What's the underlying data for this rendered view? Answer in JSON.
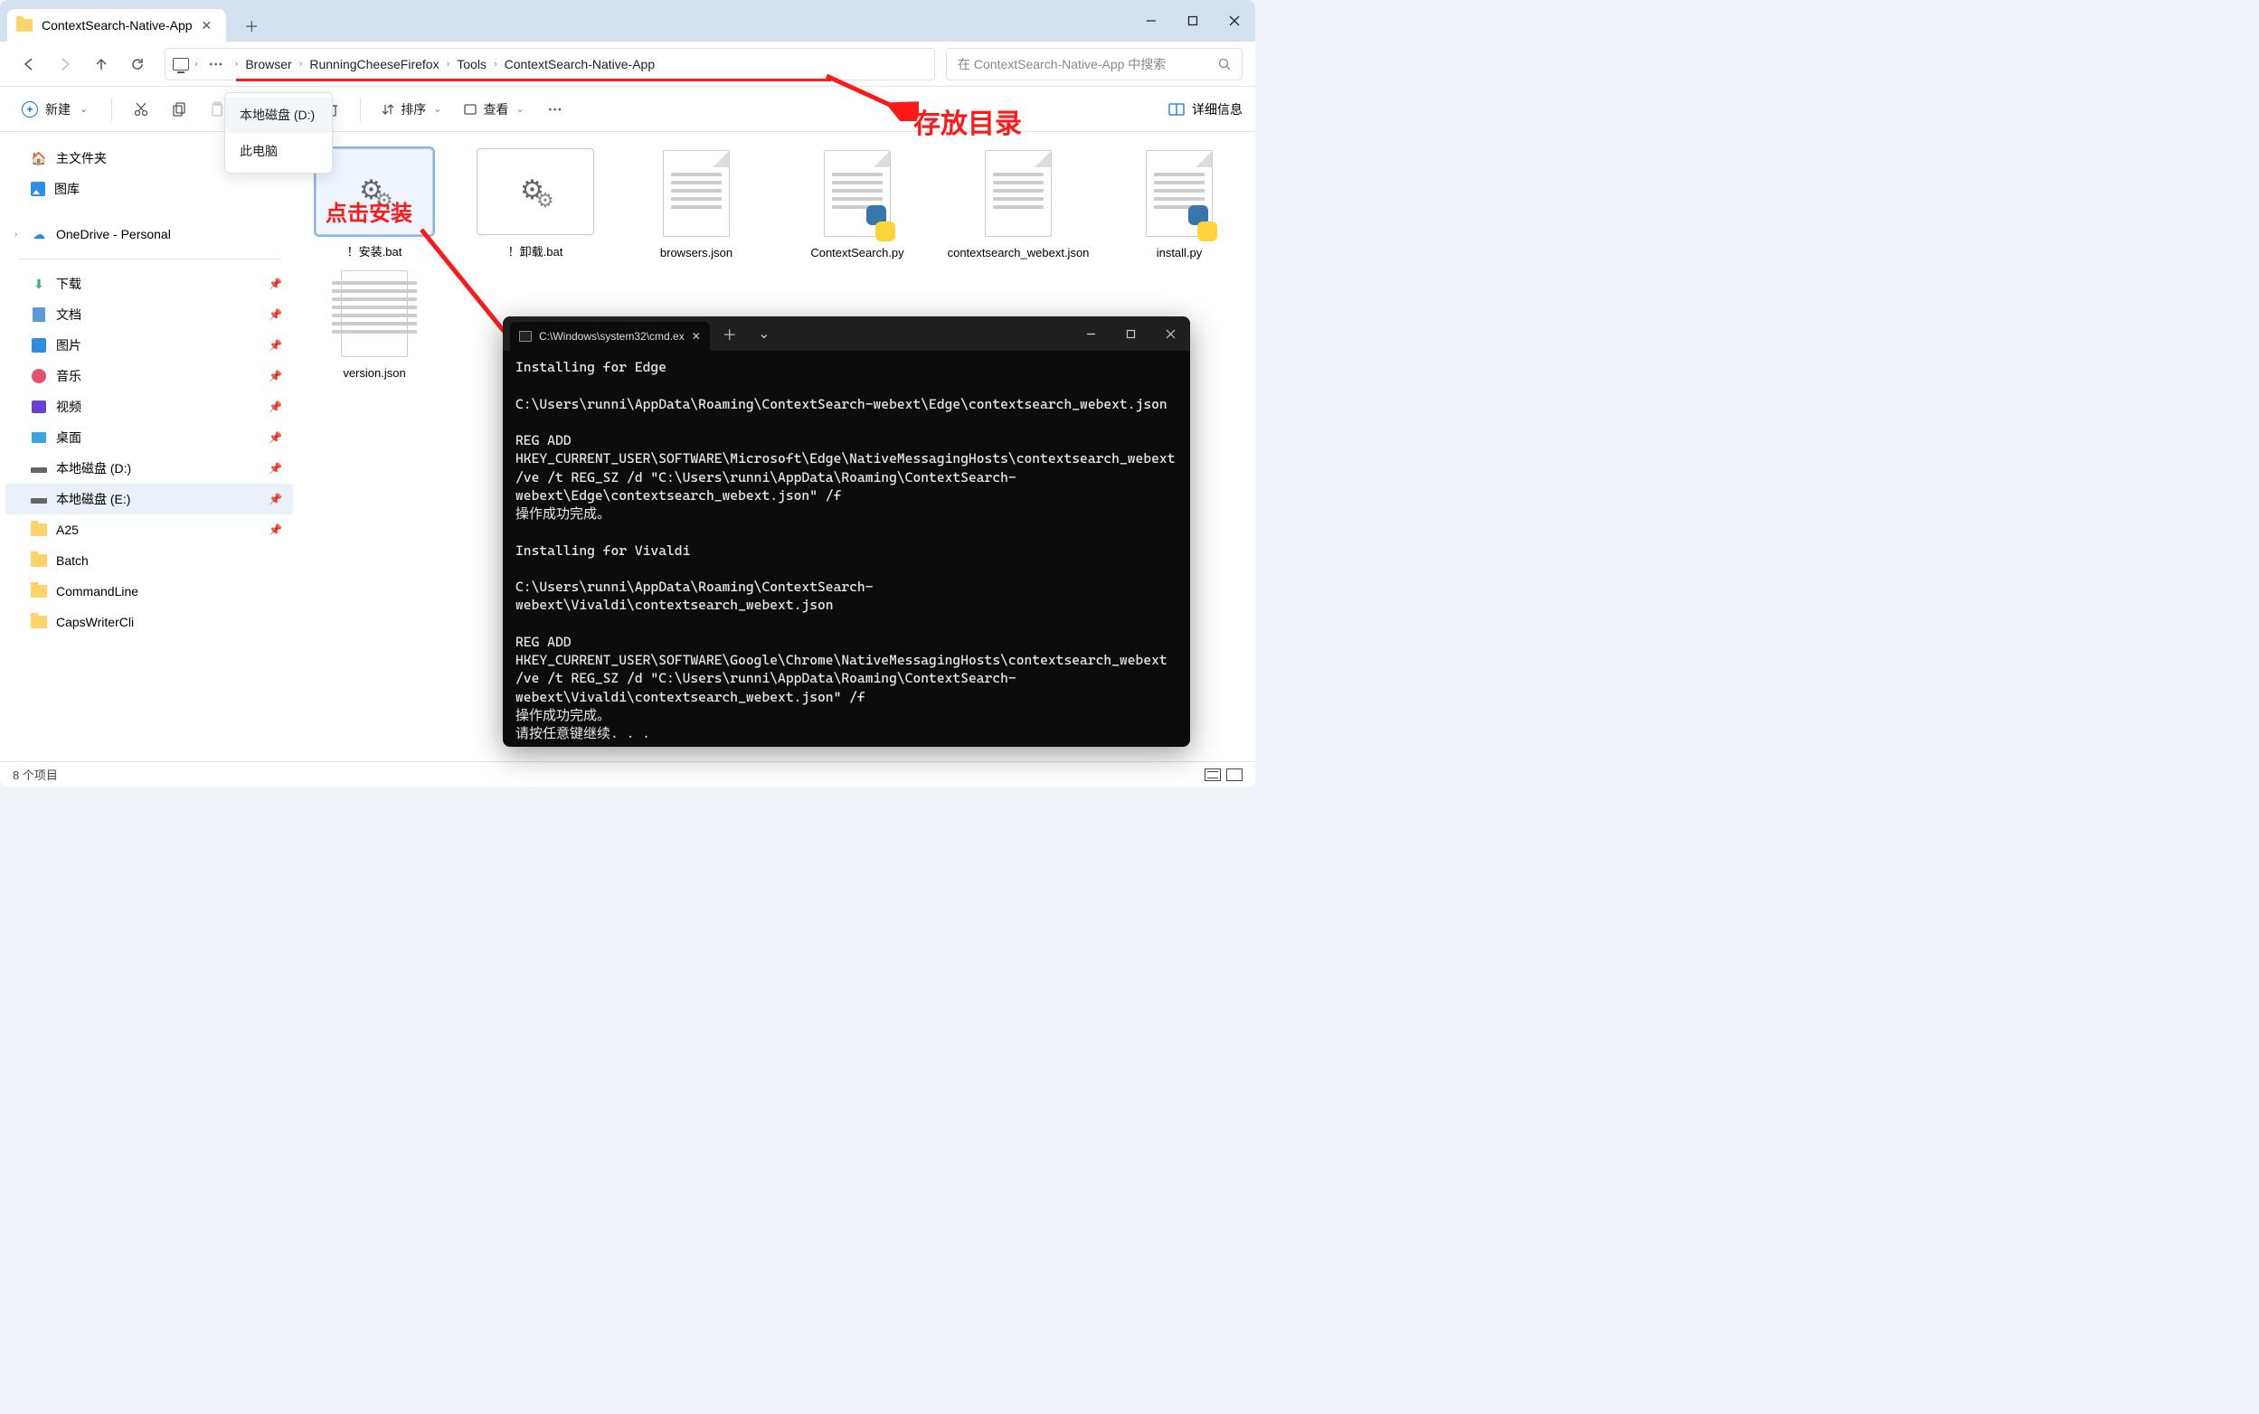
{
  "title": "ContextSearch-Native-App",
  "breadcrumb": [
    "Browser",
    "RunningCheeseFirefox",
    "Tools",
    "ContextSearch-Native-App"
  ],
  "search_placeholder": "在 ContextSearch-Native-App 中搜索",
  "toolbar": {
    "new": "新建",
    "sort": "排序",
    "view": "查看",
    "details": "详细信息"
  },
  "dropdown": {
    "item1": "本地磁盘 (D:)",
    "item2": "此电脑"
  },
  "annotations": {
    "directory": "存放目录",
    "install": "点击安装"
  },
  "sidebar": {
    "home": "主文件夹",
    "gallery": "图库",
    "onedrive": "OneDrive - Personal",
    "downloads": "下载",
    "documents": "文档",
    "pictures": "图片",
    "music": "音乐",
    "videos": "视频",
    "desktop": "桌面",
    "disk_d": "本地磁盘 (D:)",
    "disk_e": "本地磁盘 (E:)",
    "a25": "A25",
    "batch": "Batch",
    "cmdline": "CommandLine",
    "caps": "CapsWriterCli"
  },
  "files": {
    "f1": "！安装.bat",
    "f2": "！卸载.bat",
    "f3": "browsers.json",
    "f4": "ContextSearch.py",
    "f5": "contextsearch_webext.json",
    "f6": "install.py",
    "f7": "version.json"
  },
  "status": "8 个项目",
  "terminal": {
    "tab": "C:\\Windows\\system32\\cmd.ex",
    "body": "Installing for Edge\n\nC:\\Users\\runni\\AppData\\Roaming\\ContextSearch-webext\\Edge\\contextsearch_webext.json\n\nREG ADD HKEY_CURRENT_USER\\SOFTWARE\\Microsoft\\Edge\\NativeMessagingHosts\\contextsearch_webext /ve /t REG_SZ /d \"C:\\Users\\runni\\AppData\\Roaming\\ContextSearch-webext\\Edge\\contextsearch_webext.json\" /f\n操作成功完成。\n\nInstalling for Vivaldi\n\nC:\\Users\\runni\\AppData\\Roaming\\ContextSearch-webext\\Vivaldi\\contextsearch_webext.json\n\nREG ADD HKEY_CURRENT_USER\\SOFTWARE\\Google\\Chrome\\NativeMessagingHosts\\contextsearch_webext /ve /t REG_SZ /d \"C:\\Users\\runni\\AppData\\Roaming\\ContextSearch-webext\\Vivaldi\\contextsearch_webext.json\" /f\n操作成功完成。\n请按任意键继续. . . "
  }
}
